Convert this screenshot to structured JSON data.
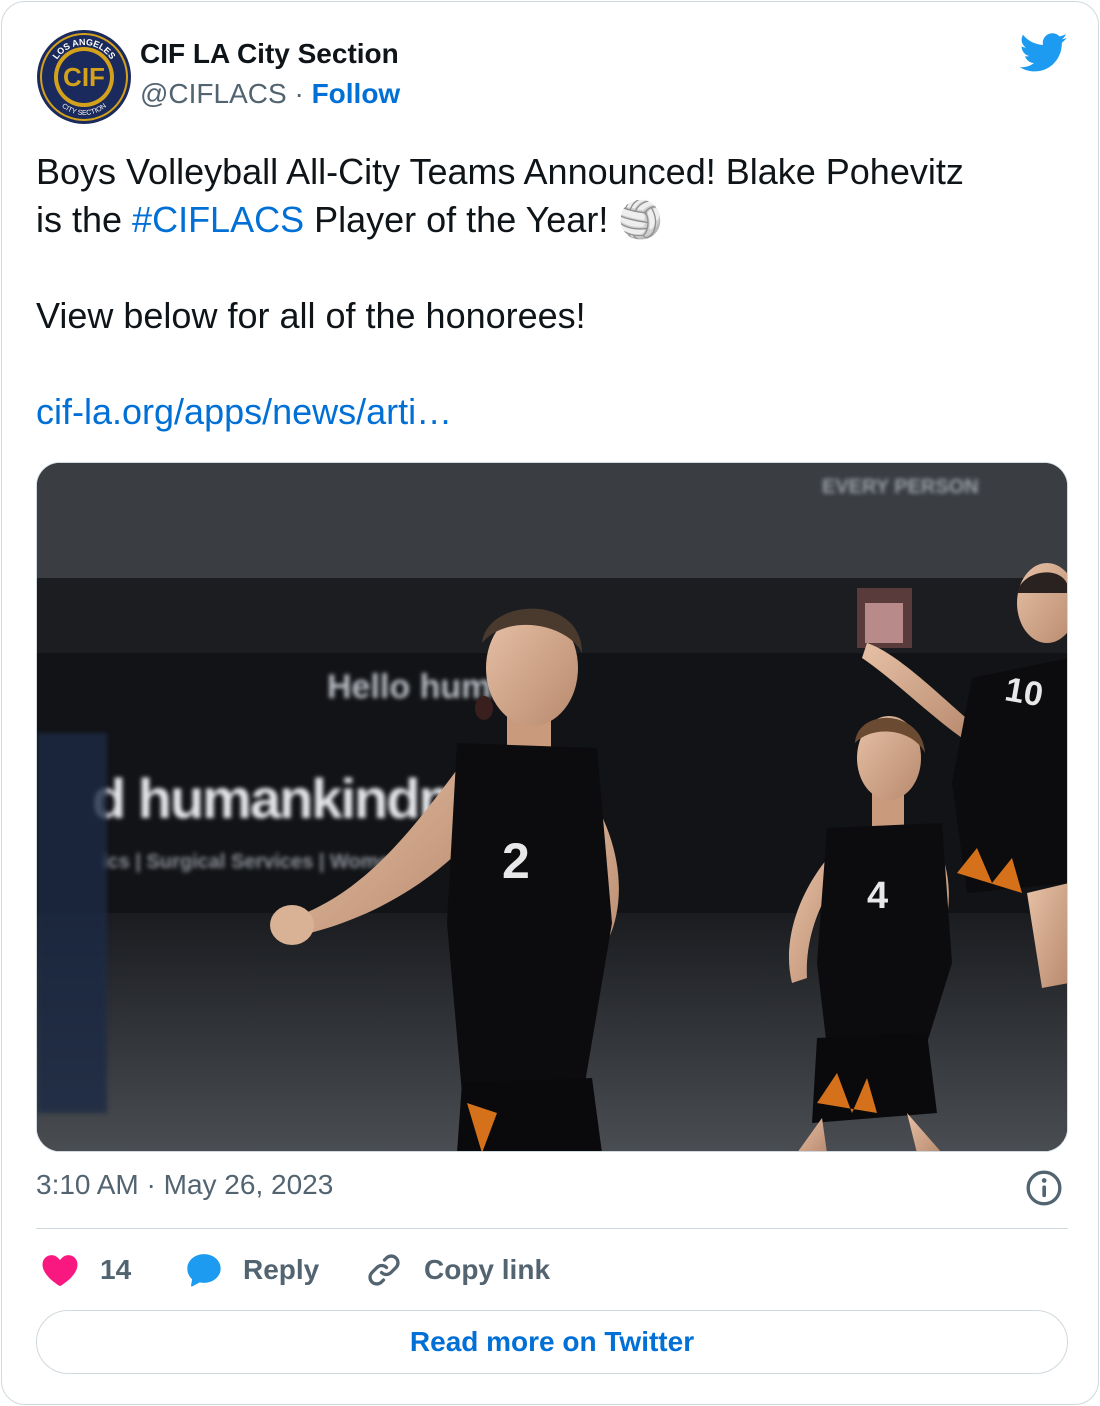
{
  "author": {
    "display_name": "CIF LA City Section",
    "handle": "@CIFLACS",
    "separator": "·",
    "follow_label": "Follow",
    "avatar_text_top": "LOS ANGELES",
    "avatar_text_center": "CIF",
    "avatar_text_bottom": "CITY SECTION"
  },
  "tweet": {
    "line1_a": "Boys Volleyball All-City Teams Announced! Blake Pohevitz",
    "line2_a": "is the ",
    "hashtag": "#CIFLACS",
    "line2_b": " Player of the Year! ",
    "emoji": "🏐",
    "line3": "View below for all of the honorees!",
    "link": "cif-la.org/apps/news/arti…"
  },
  "photo": {
    "banner_top": "EVERY PERSON",
    "banner_mid": "Hello huma",
    "banner_main": "d humankindness",
    "banner_sub": "ics | Surgical Services | Women's",
    "jersey_1": "2",
    "jersey_2": "4",
    "jersey_3": "10"
  },
  "meta": {
    "time": "3:10 AM",
    "separator": "·",
    "date": "May 26, 2023"
  },
  "actions": {
    "like_count": "14",
    "reply_label": "Reply",
    "copy_label": "Copy link"
  },
  "read_more_label": "Read more on Twitter",
  "colors": {
    "accent": "#006fd6",
    "twitter_blue": "#1d9bf0",
    "like_pink": "#f91880",
    "muted": "#536471",
    "border": "#cfd9de"
  }
}
